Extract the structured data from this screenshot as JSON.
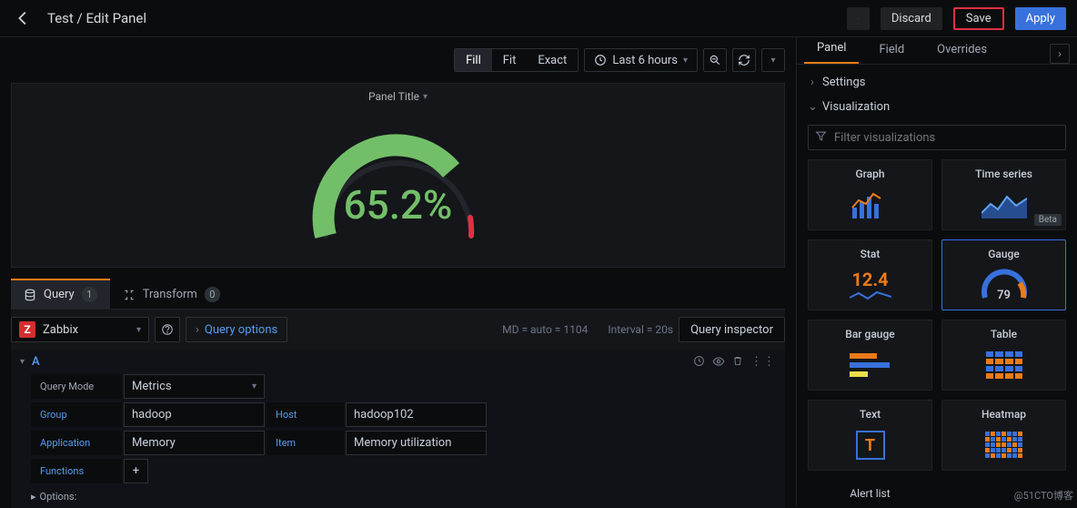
{
  "header": {
    "title": "Test / Edit Panel",
    "discard": "Discard",
    "save": "Save",
    "apply": "Apply"
  },
  "viewbar": {
    "modes": [
      "Fill",
      "Fit",
      "Exact"
    ],
    "active_mode": "Fill",
    "time_range": "Last 6 hours"
  },
  "preview": {
    "panel_title": "Panel Title",
    "gauge_value": "65.2%"
  },
  "qtabs": {
    "query": "Query",
    "query_count": "1",
    "transform": "Transform",
    "transform_count": "0"
  },
  "queryeditor": {
    "datasource": "Zabbix",
    "query_options": "Query options",
    "meta_md": "MD = auto = 1104",
    "meta_int": "Interval = 20s",
    "inspector": "Query inspector"
  },
  "queryA": {
    "letter": "A",
    "mode_label": "Query Mode",
    "mode_value": "Metrics",
    "group_label": "Group",
    "group_value": "hadoop",
    "host_label": "Host",
    "host_value": "hadoop102",
    "app_label": "Application",
    "app_value": "Memory",
    "item_label": "Item",
    "item_value": "Memory utilization",
    "functions_label": "Functions",
    "options_label": "Options:"
  },
  "side": {
    "tabs": {
      "panel": "Panel",
      "field": "Field",
      "overrides": "Overrides"
    },
    "settings": "Settings",
    "visualization": "Visualization",
    "filter_placeholder": "Filter visualizations",
    "viz": {
      "graph": "Graph",
      "timeseries": "Time series",
      "timeseries_beta": "Beta",
      "stat": "Stat",
      "stat_num": "12.4",
      "gauge": "Gauge",
      "gauge_num": "79",
      "bargauge": "Bar gauge",
      "table": "Table",
      "text": "Text",
      "heatmap": "Heatmap"
    },
    "alertlist_hint": "Alert list"
  },
  "chart_data": {
    "type": "gauge",
    "value": 65.2,
    "min": 0,
    "max": 100,
    "unit": "%",
    "thresholds": [
      {
        "color": "#73bf69",
        "from": 0,
        "to": 80
      },
      {
        "color": "#e02f44",
        "from": 80,
        "to": 100
      }
    ],
    "title": "Panel Title"
  },
  "credit": "@51CTO博客"
}
